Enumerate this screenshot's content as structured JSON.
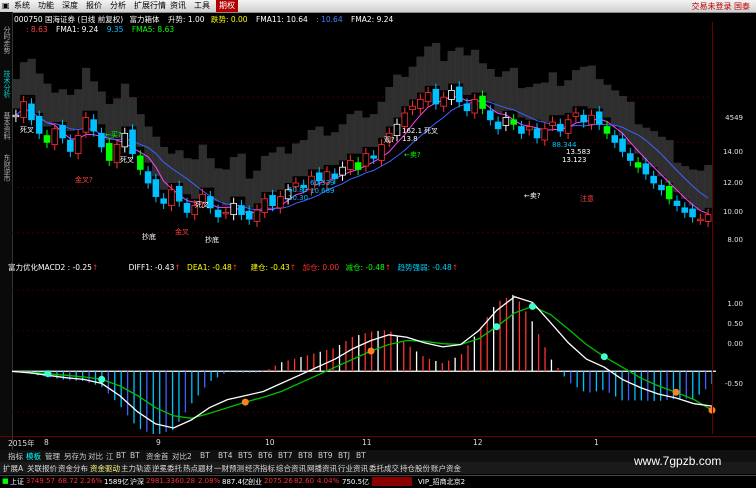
{
  "menubar": {
    "items": [
      "系统",
      "功能",
      "深度",
      "报价",
      "分析",
      "扩展行情",
      "资讯",
      "工具",
      "期权"
    ],
    "right_links": "交易未登录  国泰"
  },
  "sidetabs": [
    "分时走势",
    "技术分析",
    "基本资料",
    "东财逆市"
  ],
  "header": {
    "code": "000750",
    "name": "国海证券 (日线 前复权)",
    "formula": "富力箱体",
    "rise_label": "升势: 1.00",
    "fall_label": "跌势: 0.00",
    "fma11": "FMA11: 10.64",
    "v1": ": 10.64",
    "fma2": "FMA2: 9.24",
    "line2_a": ": 8.63",
    "fma1": "FMA1: 9.24",
    "line2_b": "9.35",
    "fma5": "FMA5: 8.63"
  },
  "macd_header": {
    "name": "富力优化MACD2 : -0.25",
    "diff": "DIFF1: -0.43",
    "dea": "DEA1: -0.48",
    "jiancang": "建仓: -0.43",
    "jiacang": "加仓: 0.00",
    "jiancang2": "减仓: -0.48",
    "trend": "趋势强弱: -0.48"
  },
  "price_axis": [
    "4549",
    "14.00",
    "12.00",
    "10.00",
    "8.00"
  ],
  "macd_axis": [
    "1.00",
    "0.50",
    "0.00",
    "-0.50"
  ],
  "date_axis": [
    "2015年",
    "8",
    "9",
    "10",
    "11",
    "12",
    "1"
  ],
  "annotations": {
    "sicha1": "死叉",
    "sicha2": "死叉",
    "sicha3": "死叉",
    "sicha4": "死叉",
    "gold1": "金叉?",
    "gold2": "金叉",
    "chaodi1": "抄底",
    "chaodi2": "抄底",
    "mai1": "←卖?",
    "mai2": "←卖?",
    "mai3": "←卖?",
    "mai4": "←买?",
    "zhu": "注意",
    "n1": "60.83",
    "n2": "10.30",
    "n3": "60.339",
    "n4": "10.689",
    "n5": "162.1",
    "n6": "13.8",
    "n7": "88.344",
    "n8": "13.583",
    "n9": "13.123",
    "guan": "观?",
    "mai_l": "←卖?"
  },
  "indicator_tabs": [
    "指标",
    "模板",
    "管理",
    "另存为",
    "对比",
    "江",
    "BT",
    "BT",
    "资金首",
    "对比2",
    "BT",
    "BT4",
    "BT5",
    "BT6",
    "BT7",
    "BT8",
    "BT9",
    "BTJ",
    "BT"
  ],
  "function_tabs": [
    "扩展A",
    "关联报价",
    "资金分布",
    "资金驱动",
    "主力轨迹",
    "逆冕委托",
    "热点题材",
    "一财预测",
    "经济指标",
    "综合资讯",
    "网播资讯",
    "行业资讯",
    "委托成交",
    "持仓股份",
    "账户资金"
  ],
  "status": {
    "sh_label": "上证",
    "sh_val": "3749.57",
    "sh_chg": "68.72",
    "sh_pct": "2.26%",
    "sh_vol": "1589亿",
    "sz_label": "沪深",
    "sz_val": "2981.33",
    "sz_chg": "60.28",
    "sz_pct": "2.08%",
    "sz_vol": "887.4亿",
    "cy_label": "创业",
    "cy_val": "2075.26",
    "cy_chg": "82.60",
    "cy_pct": "4.04%",
    "cy_vol": "750.5亿",
    "vip": "VIP_招商北京2"
  },
  "watermark": "www.7gpzb.com",
  "chart_data": [
    {
      "type": "candlestick",
      "title": "国海证券 (日线 前复权)",
      "ylim": [
        7.5,
        16
      ],
      "y_ticks": [
        8,
        10,
        12,
        14
      ],
      "close": [
        13.2,
        13.8,
        13.0,
        12.4,
        12.0,
        12.6,
        12.2,
        11.6,
        12.3,
        13.1,
        12.5,
        11.8,
        11.2,
        11.9,
        12.4,
        11.5,
        10.8,
        10.2,
        9.6,
        9.3,
        9.9,
        9.4,
        8.9,
        9.2,
        9.7,
        9.1,
        8.7,
        8.9,
        9.3,
        8.8,
        8.6,
        9.0,
        9.5,
        9.2,
        9.6,
        9.9,
        10.2,
        10.0,
        10.5,
        10.3,
        10.7,
        10.4,
        10.9,
        11.2,
        10.8,
        11.5,
        11.3,
        11.9,
        12.4,
        12.8,
        13.3,
        13.6,
        13.9,
        14.2,
        13.7,
        14.0,
        14.3,
        13.8,
        13.4,
        13.9,
        13.5,
        13.0,
        12.6,
        13.1,
        12.8,
        12.4,
        12.7,
        12.2,
        12.6,
        12.9,
        12.5,
        13.0,
        13.3,
        12.9,
        13.2,
        12.8,
        12.4,
        12.0,
        11.6,
        11.2,
        10.9,
        10.6,
        10.2,
        9.9,
        9.5,
        9.2,
        8.9,
        8.7,
        8.6,
        8.8
      ]
    },
    {
      "type": "bar",
      "title": "富力优化MACD2",
      "ylim": [
        -0.7,
        1.2
      ],
      "y_ticks": [
        -0.5,
        0,
        0.5,
        1.0
      ],
      "series": [
        {
          "name": "DIFF1",
          "values": [
            0.0,
            -0.02,
            -0.05,
            -0.08,
            -0.1,
            -0.15,
            -0.3,
            -0.5,
            -0.65,
            -0.7,
            -0.6,
            -0.45,
            -0.35,
            -0.3,
            -0.25,
            -0.15,
            -0.05,
            0.05,
            0.15,
            0.28,
            0.38,
            0.45,
            0.42,
            0.35,
            0.3,
            0.33,
            0.5,
            0.75,
            0.92,
            0.85,
            0.6,
            0.35,
            0.15,
            0.05,
            -0.1,
            -0.2,
            -0.28,
            -0.33,
            -0.4,
            -0.43
          ]
        },
        {
          "name": "DEA1",
          "values": [
            0.0,
            -0.01,
            -0.03,
            -0.05,
            -0.07,
            -0.1,
            -0.18,
            -0.3,
            -0.45,
            -0.55,
            -0.58,
            -0.52,
            -0.45,
            -0.38,
            -0.32,
            -0.25,
            -0.15,
            -0.05,
            0.05,
            0.15,
            0.25,
            0.33,
            0.38,
            0.37,
            0.34,
            0.33,
            0.4,
            0.55,
            0.72,
            0.8,
            0.7,
            0.52,
            0.33,
            0.18,
            0.05,
            -0.08,
            -0.18,
            -0.26,
            -0.35,
            -0.48
          ]
        }
      ]
    }
  ]
}
